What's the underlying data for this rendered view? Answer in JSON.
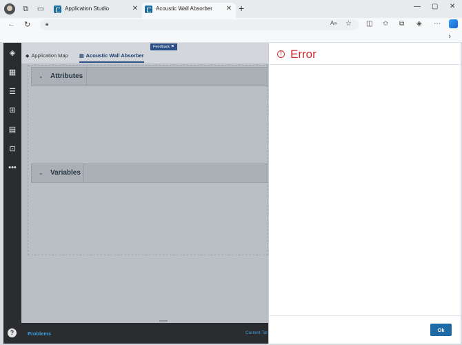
{
  "browser": {
    "tabs": [
      {
        "label": "Application Studio",
        "active": false
      },
      {
        "label": "Acoustic Wall Absorber",
        "active": true
      }
    ],
    "url": ""
  },
  "app": {
    "tabs": [
      {
        "label": "Application Map",
        "icon": "layers-icon"
      },
      {
        "label": "Acoustic Wall Absorber",
        "icon": "table-icon",
        "active": true
      }
    ],
    "feedback_label": "Feedback",
    "sections": [
      {
        "title": "Attributes"
      },
      {
        "title": "Variables"
      }
    ],
    "bottom": {
      "problems_label": "Problems",
      "current_label": "Current Tal"
    }
  },
  "dialog": {
    "title": "Error",
    "ok_label": "Ok"
  },
  "colors": {
    "error": "#cc2d2d",
    "primary": "#1d6aa6",
    "sidebar": "#2a2c2f"
  }
}
